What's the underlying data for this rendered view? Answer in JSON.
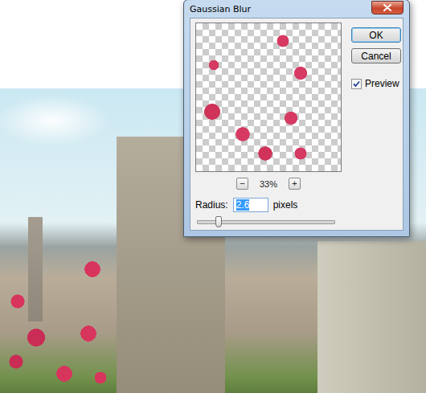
{
  "dialog": {
    "title": "Gaussian Blur",
    "buttons": [
      {
        "label": "OK",
        "default": true
      },
      {
        "label": "Cancel",
        "default": false
      }
    ],
    "preview": {
      "label": "Preview",
      "checked": true
    },
    "zoom": {
      "out": "−",
      "level": "33%",
      "in": "+"
    },
    "radius": {
      "label": "Radius:",
      "value": "2.6",
      "selected": true,
      "unit": "pixels",
      "level": 0.15
    }
  }
}
